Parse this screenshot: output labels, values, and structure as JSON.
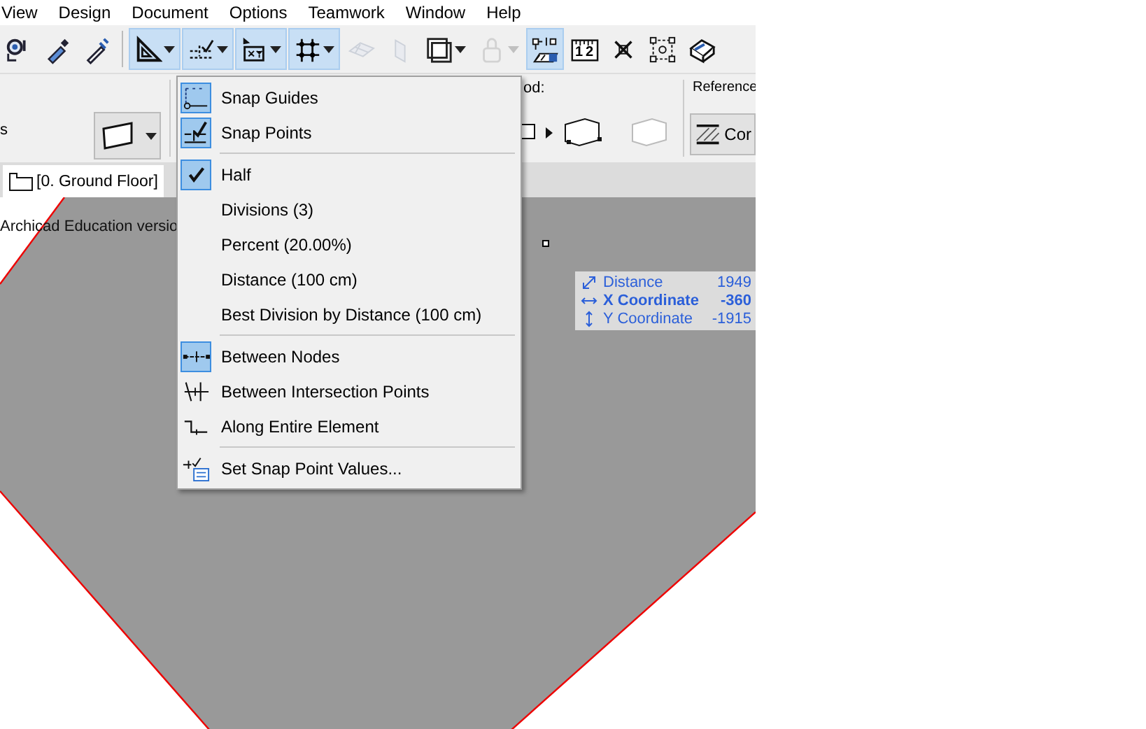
{
  "menu_bar": [
    "View",
    "Design",
    "Document",
    "Options",
    "Teamwork",
    "Window",
    "Help"
  ],
  "toolbar": [
    {
      "active": false,
      "dropdown": false,
      "disabled": false
    },
    {
      "active": false,
      "dropdown": false,
      "disabled": false
    },
    {
      "active": false,
      "dropdown": false,
      "disabled": false
    },
    {
      "active": true,
      "dropdown": true,
      "disabled": false
    },
    {
      "active": true,
      "dropdown": true,
      "disabled": false
    },
    {
      "active": true,
      "dropdown": true,
      "disabled": false
    },
    {
      "active": true,
      "dropdown": true,
      "disabled": false
    },
    {
      "active": false,
      "dropdown": false,
      "disabled": true
    },
    {
      "active": false,
      "dropdown": false,
      "disabled": true
    },
    {
      "active": false,
      "dropdown": true,
      "disabled": false
    },
    {
      "active": false,
      "dropdown": true,
      "disabled": true
    },
    {
      "active": true,
      "dropdown": false,
      "disabled": false
    },
    {
      "active": false,
      "dropdown": false,
      "disabled": false,
      "label": "12"
    },
    {
      "active": false,
      "dropdown": false,
      "disabled": false
    },
    {
      "active": false,
      "dropdown": false,
      "disabled": false
    },
    {
      "active": false,
      "dropdown": false,
      "disabled": false
    }
  ],
  "info_box": {
    "left_label": "s",
    "method_label": "od:",
    "reference_label": "Reference",
    "reference_button": "Cor"
  },
  "floor_tab": {
    "label": "[0. Ground Floor]",
    "selected": true
  },
  "canvas": {
    "watermark": "Archicad Education versio"
  },
  "snap_menu": [
    {
      "kind": "toggle",
      "label": "Snap Guides",
      "on": true
    },
    {
      "kind": "toggle",
      "label": "Snap Points",
      "on": true
    },
    {
      "kind": "separator"
    },
    {
      "kind": "radio",
      "label": "Half",
      "on": true
    },
    {
      "kind": "radio",
      "label": "Divisions (3)",
      "on": false
    },
    {
      "kind": "radio",
      "label": "Percent (20.00%)",
      "on": false
    },
    {
      "kind": "radio",
      "label": "Distance (100 cm)",
      "on": false
    },
    {
      "kind": "radio",
      "label": "Best Division by Distance (100 cm)",
      "on": false
    },
    {
      "kind": "separator"
    },
    {
      "kind": "toggle",
      "label": "Between Nodes",
      "on": true
    },
    {
      "kind": "toggle",
      "label": "Between Intersection Points",
      "on": false
    },
    {
      "kind": "toggle",
      "label": "Along Entire Element",
      "on": false
    },
    {
      "kind": "separator"
    },
    {
      "kind": "command",
      "label": "Set Snap Point Values..."
    }
  ],
  "tracker": [
    {
      "label": "Distance",
      "value": "1949",
      "bold": false
    },
    {
      "label": "X Coordinate",
      "value": "-360",
      "bold": true
    },
    {
      "label": "Y Coordinate",
      "value": "-1915",
      "bold": false
    }
  ]
}
